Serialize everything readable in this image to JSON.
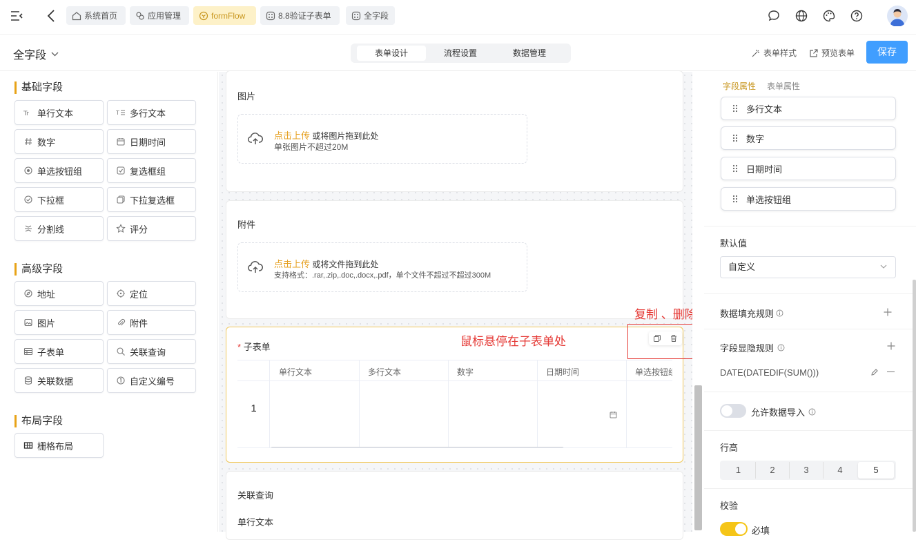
{
  "topbar": {
    "tabs": [
      {
        "label": "系统首页",
        "icon": "home-icon"
      },
      {
        "label": "应用管理",
        "icon": "app-icon"
      },
      {
        "label": "formFlow",
        "icon": "flow-icon"
      },
      {
        "label": "8.8验证子表单",
        "icon": "grid-icon"
      },
      {
        "label": "全字段",
        "icon": "grid-icon"
      }
    ],
    "active_tab": "formFlow"
  },
  "subbar": {
    "form_name": "全字段",
    "segments": [
      "表单设计",
      "流程设置",
      "数据管理"
    ],
    "active_segment": "表单设计",
    "style_label": "表单样式",
    "preview_label": "预览表单",
    "save_label": "保存"
  },
  "left": {
    "groups": [
      {
        "title": "基础字段",
        "items": [
          "单行文本",
          "多行文本",
          "数字",
          "日期时间",
          "单选按钮组",
          "复选框组",
          "下拉框",
          "下拉复选框",
          "分割线",
          "评分"
        ]
      },
      {
        "title": "高级字段",
        "items": [
          "地址",
          "定位",
          "图片",
          "附件",
          "子表单",
          "关联查询",
          "关联数据",
          "自定义编号"
        ]
      },
      {
        "title": "布局字段",
        "items": [
          "栅格布局"
        ]
      }
    ]
  },
  "canvas": {
    "image": {
      "label": "图片",
      "upload_link": "点击上传",
      "upload_text": " 或将图片拖到此处",
      "hint": "单张图片不超过20M"
    },
    "attachment": {
      "label": "附件",
      "upload_link": "点击上传",
      "upload_text": " 或将文件拖到此处",
      "hint": "支持格式：.rar,.zip,.doc,.docx,.pdf，单个文件不超过不超过300M"
    },
    "subform": {
      "required_mark": "*",
      "label": "子表单",
      "columns": [
        "单行文本",
        "多行文本",
        "数字",
        "日期时间",
        "单选按钮组"
      ],
      "row_index": "1"
    },
    "relation": {
      "label": "关联查询",
      "field": "单行文本"
    },
    "annotation_copy_delete": "复制 、删除",
    "annotation_hover": "鼠标悬停在子表单处"
  },
  "right": {
    "tabs": [
      "字段属性",
      "表单属性"
    ],
    "active_tab": "字段属性",
    "columns_list": [
      "多行文本",
      "数字",
      "日期时间",
      "单选按钮组"
    ],
    "default_label": "默认值",
    "default_value": "自定义",
    "fill_rule_label": "数据填充规则",
    "visibility_rule_label": "字段显隐规则",
    "formula": "DATE(DATEDIF(SUM()))",
    "allow_import_label": "允许数据导入",
    "row_height_label": "行高",
    "row_heights": [
      "1",
      "2",
      "3",
      "4",
      "5"
    ],
    "row_height_selected": "5",
    "validation_label": "校验",
    "required_label": "必填"
  },
  "colors": {
    "accent": "#e8a317",
    "primary": "#409eff",
    "annotation": "#e53935"
  }
}
